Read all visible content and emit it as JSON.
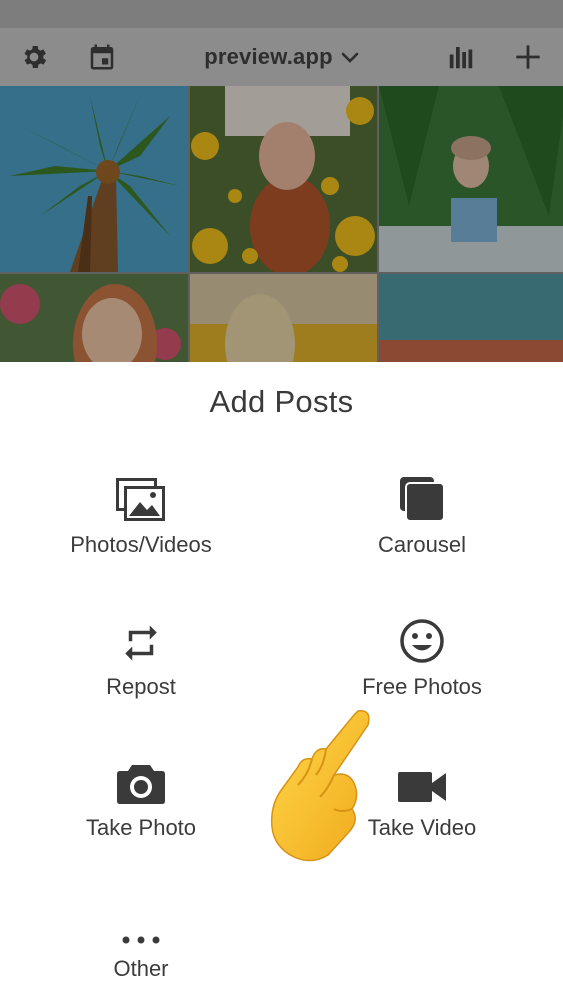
{
  "topbar": {
    "account_name": "preview.app",
    "icons": [
      "gear-icon",
      "calendar-icon",
      "chevron-down-icon",
      "bar-chart-icon",
      "plus-icon"
    ]
  },
  "grid": {
    "tiles": [
      "palm-tree-photo",
      "sunflowers-photo",
      "pool-palms-photo",
      "smiling-woman-photo",
      "blonde-hair-photo",
      "water-flowers-photo"
    ]
  },
  "sheet": {
    "title": "Add Posts",
    "options": [
      {
        "label": "Photos/Videos",
        "icon": "photos-icon"
      },
      {
        "label": "Carousel",
        "icon": "carousel-icon"
      },
      {
        "label": "Repost",
        "icon": "repost-icon"
      },
      {
        "label": "Free Photos",
        "icon": "smiley-icon"
      },
      {
        "label": "Take Photo",
        "icon": "camera-icon"
      },
      {
        "label": "Take Video",
        "icon": "video-camera-icon"
      },
      {
        "label": "Other",
        "icon": "more-dots-icon"
      }
    ]
  },
  "overlay": {
    "emoji": "pointing-hand-emoji"
  },
  "colors": {
    "icon": "#3a3a3a",
    "dim_bar": "#8c8c8c",
    "hand": "#f7c531"
  }
}
